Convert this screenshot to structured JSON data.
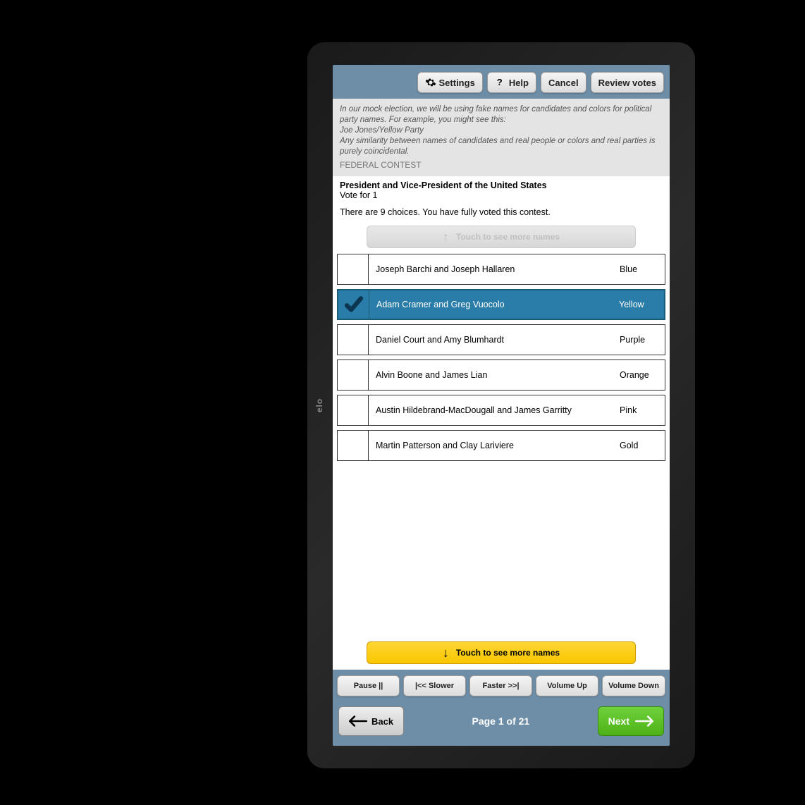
{
  "device": {
    "brand": "elo"
  },
  "toolbar": {
    "settings": "Settings",
    "help": "Help",
    "cancel": "Cancel",
    "review": "Review votes"
  },
  "disclaimer": {
    "line1": "In our mock election, we will be using fake names for candidates and colors for political party names.  For example, you might see this:",
    "line2": "Joe Jones/Yellow Party",
    "line3": "Any similarity between names of candidates and real people or colors and real parties is purely coincidental.",
    "section": "FEDERAL CONTEST"
  },
  "contest": {
    "title": "President and Vice-President of the United States",
    "vote_for": "Vote for 1",
    "status": "There are 9 choices. You have fully voted this contest."
  },
  "scroll": {
    "up_label": "Touch to see more names",
    "down_label": "Touch to see more names"
  },
  "candidates": [
    {
      "name": "Joseph Barchi and Joseph Hallaren",
      "party": "Blue",
      "selected": false
    },
    {
      "name": "Adam Cramer and Greg Vuocolo",
      "party": "Yellow",
      "selected": true
    },
    {
      "name": "Daniel Court and Amy Blumhardt",
      "party": "Purple",
      "selected": false
    },
    {
      "name": "Alvin Boone and James Lian",
      "party": "Orange",
      "selected": false
    },
    {
      "name": "Austin Hildebrand-MacDougall and James Garritty",
      "party": "Pink",
      "selected": false
    },
    {
      "name": "Martin Patterson and Clay Lariviere",
      "party": "Gold",
      "selected": false
    }
  ],
  "audio": {
    "pause": "Pause ||",
    "slower": "|<< Slower",
    "faster": "Faster >>|",
    "vol_up": "Volume Up",
    "vol_down": "Volume Down"
  },
  "nav": {
    "back": "Back",
    "page": "Page 1 of 21",
    "next": "Next"
  }
}
